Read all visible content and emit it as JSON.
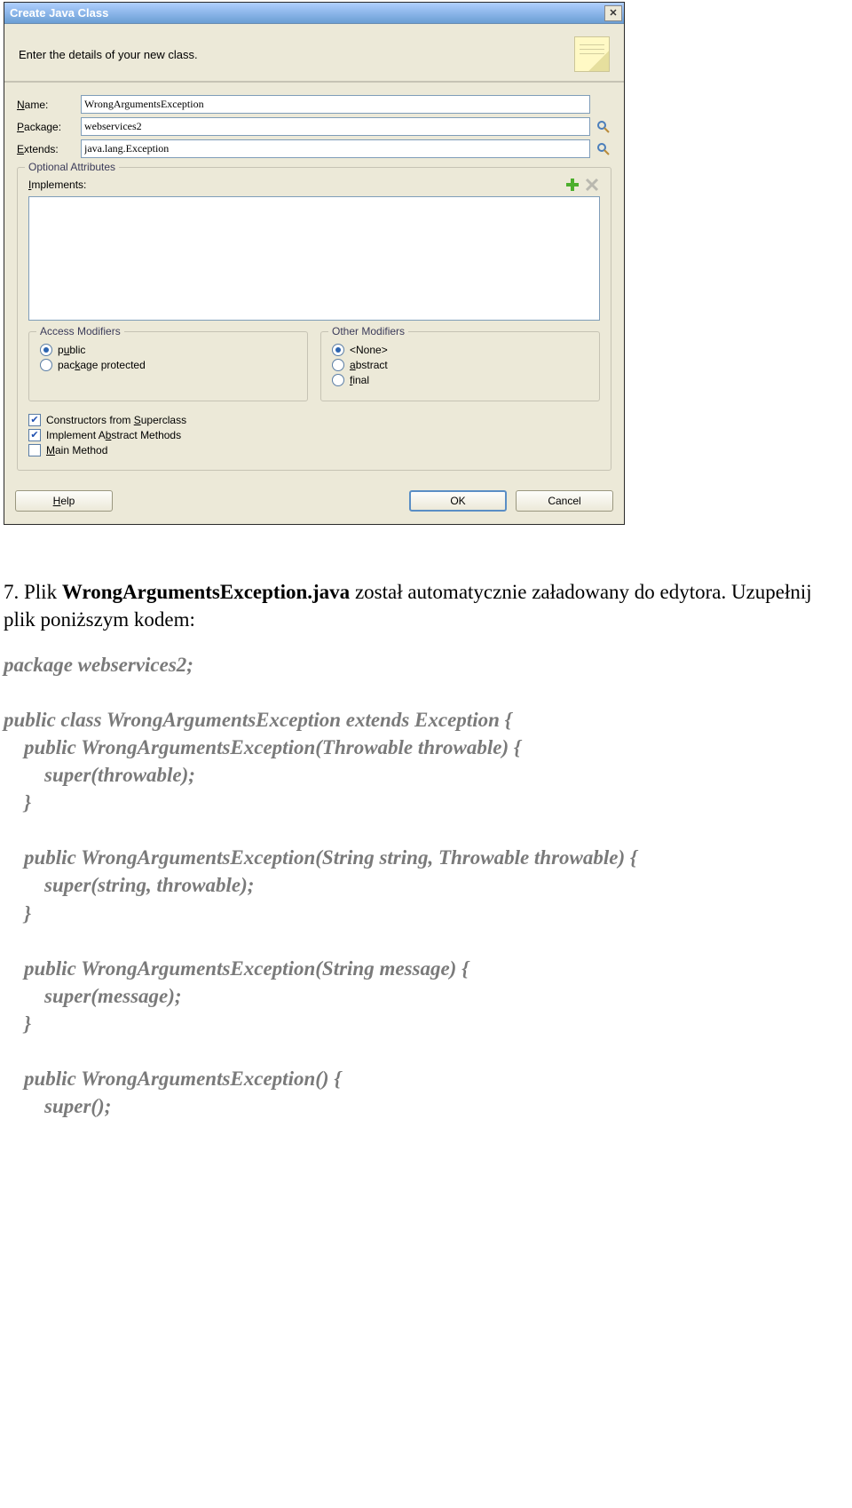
{
  "dialog": {
    "title": "Create Java Class",
    "subtitle": "Enter the details of your new class.",
    "fields": {
      "name_label": "Name:",
      "name_value": "WrongArgumentsException",
      "package_label": "Package:",
      "package_value": "webservices2",
      "extends_label": "Extends:",
      "extends_value": "java.lang.Exception"
    },
    "optional": {
      "legend": "Optional Attributes",
      "implements_label": "Implements:"
    },
    "access": {
      "legend": "Access Modifiers",
      "public": "public",
      "package_protected": "package protected"
    },
    "other": {
      "legend": "Other Modifiers",
      "none": "<None>",
      "abstract": "abstract",
      "final": "final"
    },
    "checks": {
      "constructors": "Constructors from Superclass",
      "implement": "Implement Abstract Methods",
      "main": "Main Method"
    },
    "buttons": {
      "help": "Help",
      "ok": "OK",
      "cancel": "Cancel"
    }
  },
  "doc": {
    "p1a": "7. Plik ",
    "p1b": "WrongArgumentsException.java",
    "p1c": " został automatycznie załadowany do edytora.  Uzupełnij plik poniższym kodem:",
    "code": {
      "l1": "package webservices2;",
      "l2a": "public class WrongArgumentsException extends Exception {",
      "l3": "    public WrongArgumentsException(Throwable throwable) {",
      "l4": "        super(throwable);",
      "l5": "    }",
      "l6": "    public WrongArgumentsException(String string, Throwable throwable) {",
      "l7": "        super(string, throwable);",
      "l8": "    }",
      "l9": "    public WrongArgumentsException(String message) {",
      "l10": "        super(message);",
      "l11": "    }",
      "l12": "    public WrongArgumentsException() {",
      "l13": "        super();"
    }
  }
}
